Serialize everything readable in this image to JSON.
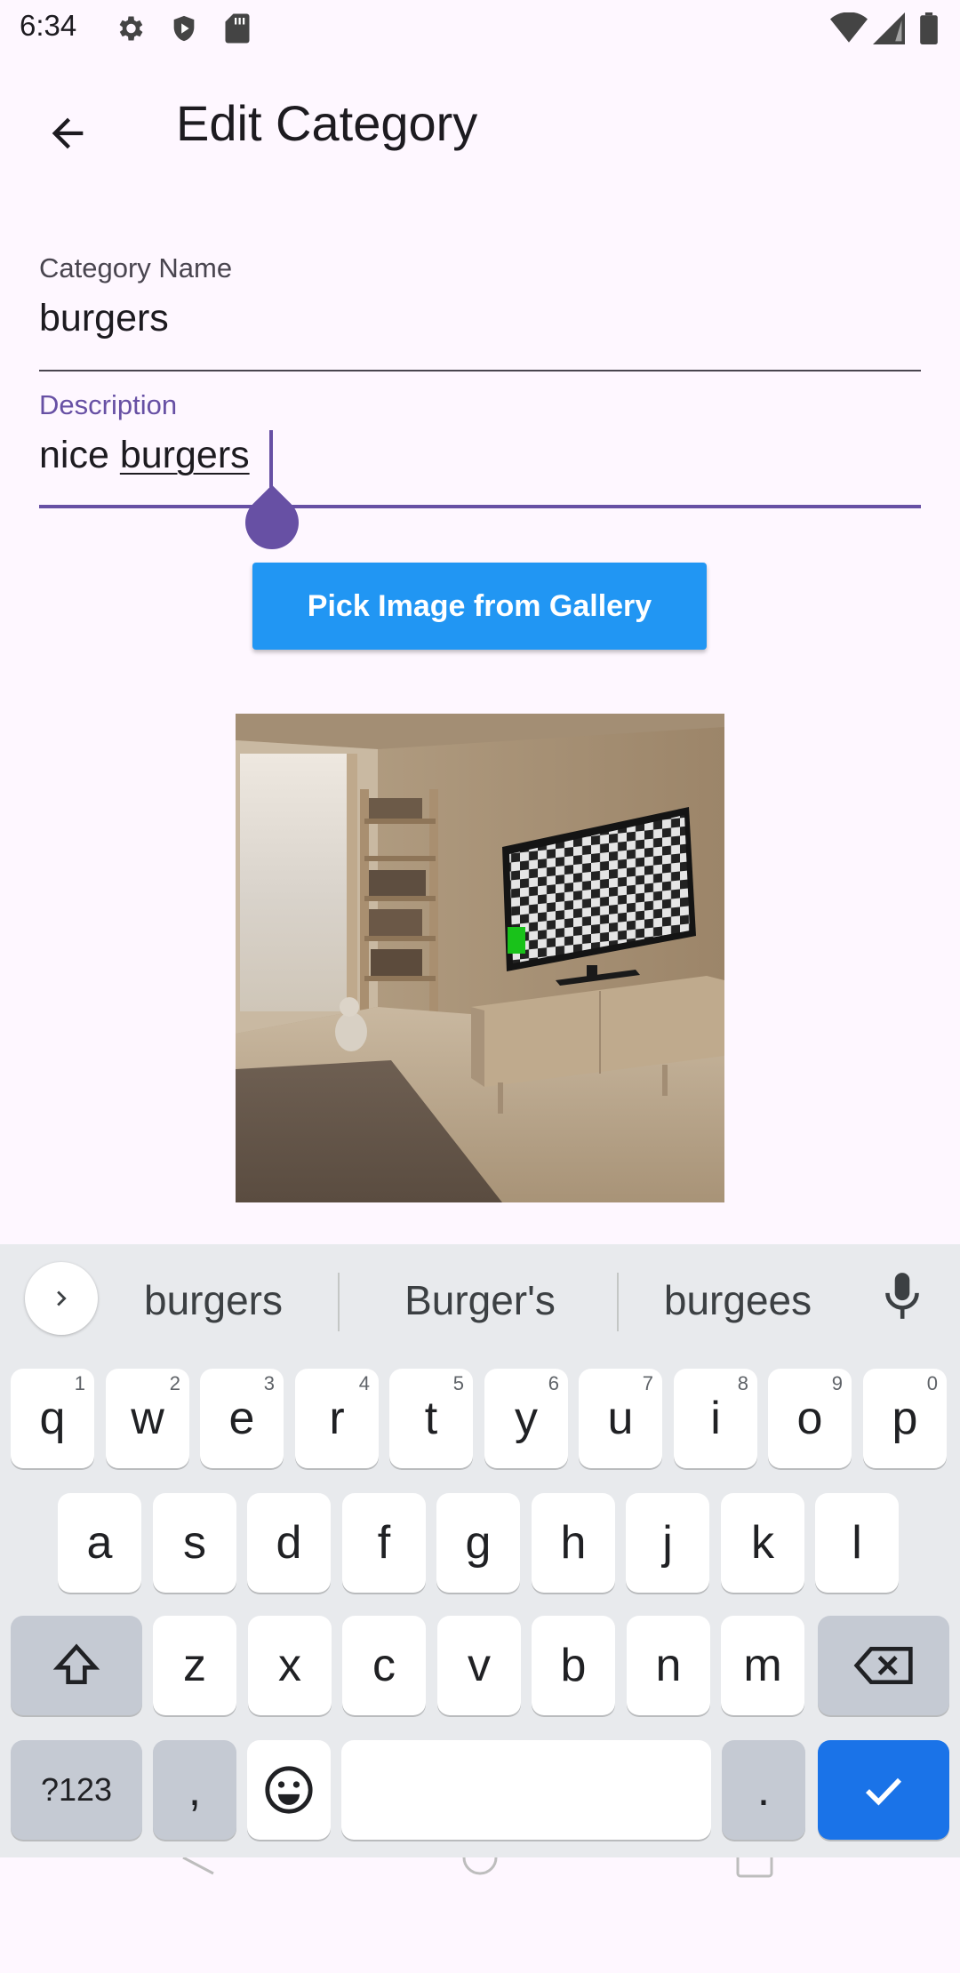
{
  "status_bar": {
    "time": "6:34",
    "left_icons": [
      "gear-icon",
      "shield-icon",
      "sd-card-icon"
    ],
    "right_icons": [
      "wifi-icon",
      "signal-icon",
      "battery-icon"
    ]
  },
  "app_bar": {
    "title": "Edit Category",
    "back_icon": "arrow-back-icon"
  },
  "form": {
    "category_name": {
      "label": "Category Name",
      "value": "burgers"
    },
    "description": {
      "label": "Description",
      "value_prefix": "nice ",
      "value_composing": "burgers"
    },
    "pick_image_button": "Pick Image from Gallery",
    "accent_color": "#6750A4",
    "button_color": "#2196F3"
  },
  "keyboard": {
    "suggestions": [
      "burgers",
      "Burger's",
      "burgees"
    ],
    "rows": [
      [
        {
          "k": "q",
          "h": "1"
        },
        {
          "k": "w",
          "h": "2"
        },
        {
          "k": "e",
          "h": "3"
        },
        {
          "k": "r",
          "h": "4"
        },
        {
          "k": "t",
          "h": "5"
        },
        {
          "k": "y",
          "h": "6"
        },
        {
          "k": "u",
          "h": "7"
        },
        {
          "k": "i",
          "h": "8"
        },
        {
          "k": "o",
          "h": "9"
        },
        {
          "k": "p",
          "h": "0"
        }
      ],
      [
        {
          "k": "a"
        },
        {
          "k": "s"
        },
        {
          "k": "d"
        },
        {
          "k": "f"
        },
        {
          "k": "g"
        },
        {
          "k": "h"
        },
        {
          "k": "j"
        },
        {
          "k": "k"
        },
        {
          "k": "l"
        }
      ],
      [
        {
          "k": "z"
        },
        {
          "k": "x"
        },
        {
          "k": "c"
        },
        {
          "k": "v"
        },
        {
          "k": "b"
        },
        {
          "k": "n"
        },
        {
          "k": "m"
        }
      ]
    ],
    "symbols_key": "?123",
    "comma_key": ",",
    "period_key": ".",
    "enter_color": "#1A73E8"
  }
}
